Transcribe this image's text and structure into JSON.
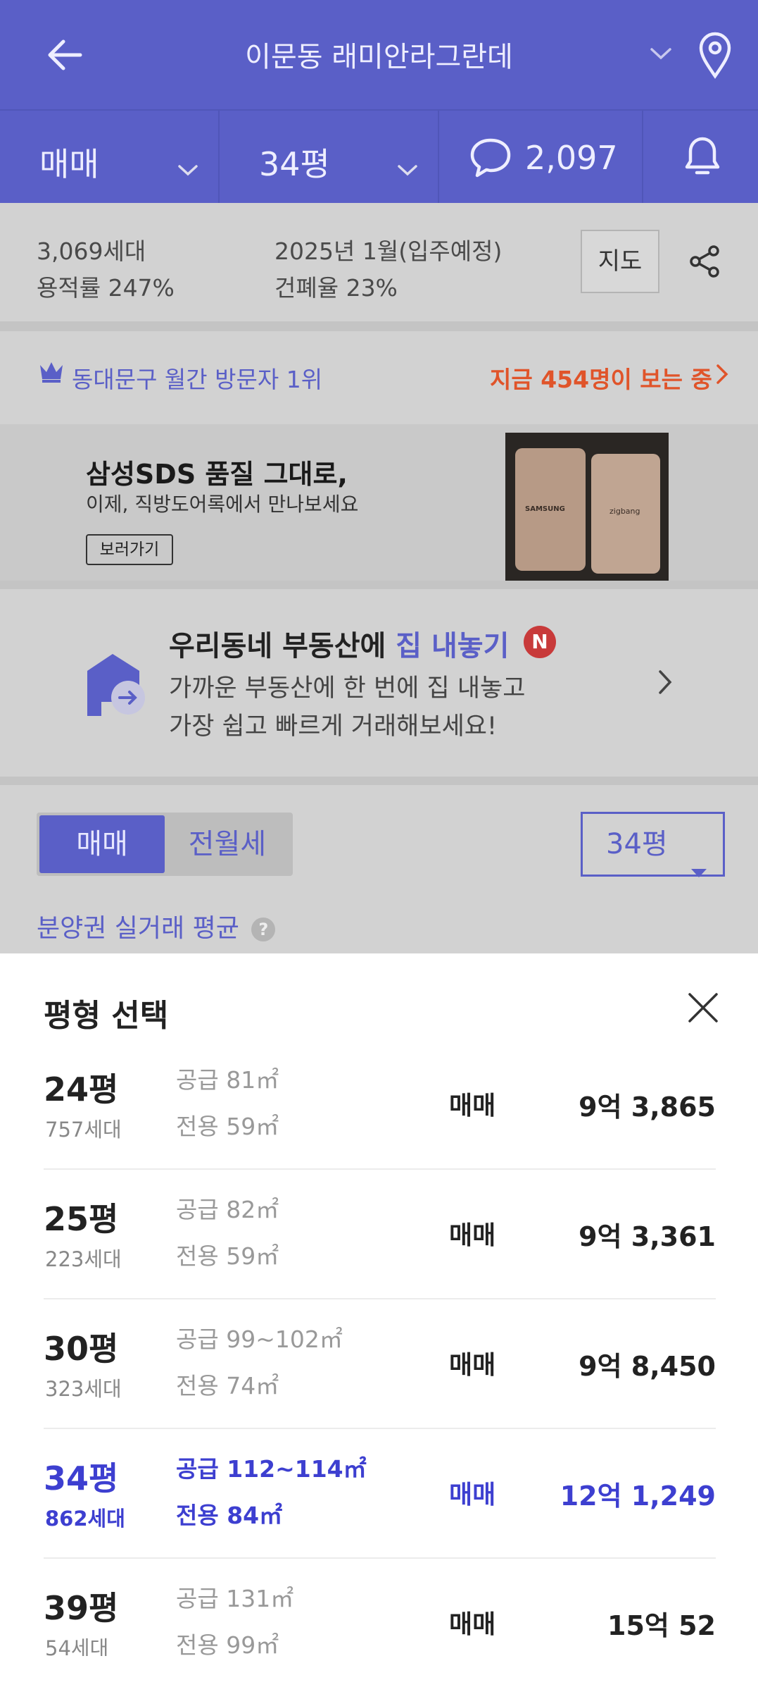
{
  "header": {
    "title": "이문동 래미안라그란데"
  },
  "filters": {
    "deal_type": "매매",
    "size": "34평",
    "comments": "2,097"
  },
  "summary": {
    "households": "3,069세대",
    "floor_area_ratio": "용적률 247%",
    "move_in": "2025년 1월(입주예정)",
    "coverage_ratio": "건폐율 23%",
    "map_label": "지도"
  },
  "rank": {
    "text": "동대문구 월간 방문자 1위",
    "live": "지금 454명이 보는 중"
  },
  "ad": {
    "title": "삼성SDS 품질 그대로,",
    "subtitle": "이제, 직방도어록에서 만나보세요",
    "cta": "보러가기",
    "brand1": "SAMSUNG",
    "brand2": "zigbang"
  },
  "promo": {
    "title_prefix": "우리동네 부동산에 ",
    "title_highlight": "집 내놓기",
    "badge": "N",
    "line1": "가까운 부동산에 한 번에 집 내놓고",
    "line2": "가장 쉽고 빠르게 거래해보세요!"
  },
  "tabs": {
    "tab1": "매매",
    "tab2": "전월세",
    "size": "34평"
  },
  "avg_label": "분양권 실거래 평균",
  "sheet": {
    "title": "평형 선택",
    "rows": [
      {
        "pyeong": "24평",
        "households": "757세대",
        "supply": "공급 81㎡",
        "exclusive": "전용 59㎡",
        "type": "매매",
        "price": "9억 3,865"
      },
      {
        "pyeong": "25평",
        "households": "223세대",
        "supply": "공급 82㎡",
        "exclusive": "전용 59㎡",
        "type": "매매",
        "price": "9억 3,361"
      },
      {
        "pyeong": "30평",
        "households": "323세대",
        "supply": "공급 99~102㎡",
        "exclusive": "전용 74㎡",
        "type": "매매",
        "price": "9억 8,450"
      },
      {
        "pyeong": "34평",
        "households": "862세대",
        "supply": "공급 112~114㎡",
        "exclusive": "전용 84㎡",
        "type": "매매",
        "price": "12억 1,249"
      },
      {
        "pyeong": "39평",
        "households": "54세대",
        "supply": "공급 131㎡",
        "exclusive": "전용 99㎡",
        "type": "매매",
        "price": "15억 52"
      }
    ]
  },
  "colors": {
    "brand": "#5a5fc7",
    "selected": "#3d3fd0",
    "live": "#e0542a"
  }
}
